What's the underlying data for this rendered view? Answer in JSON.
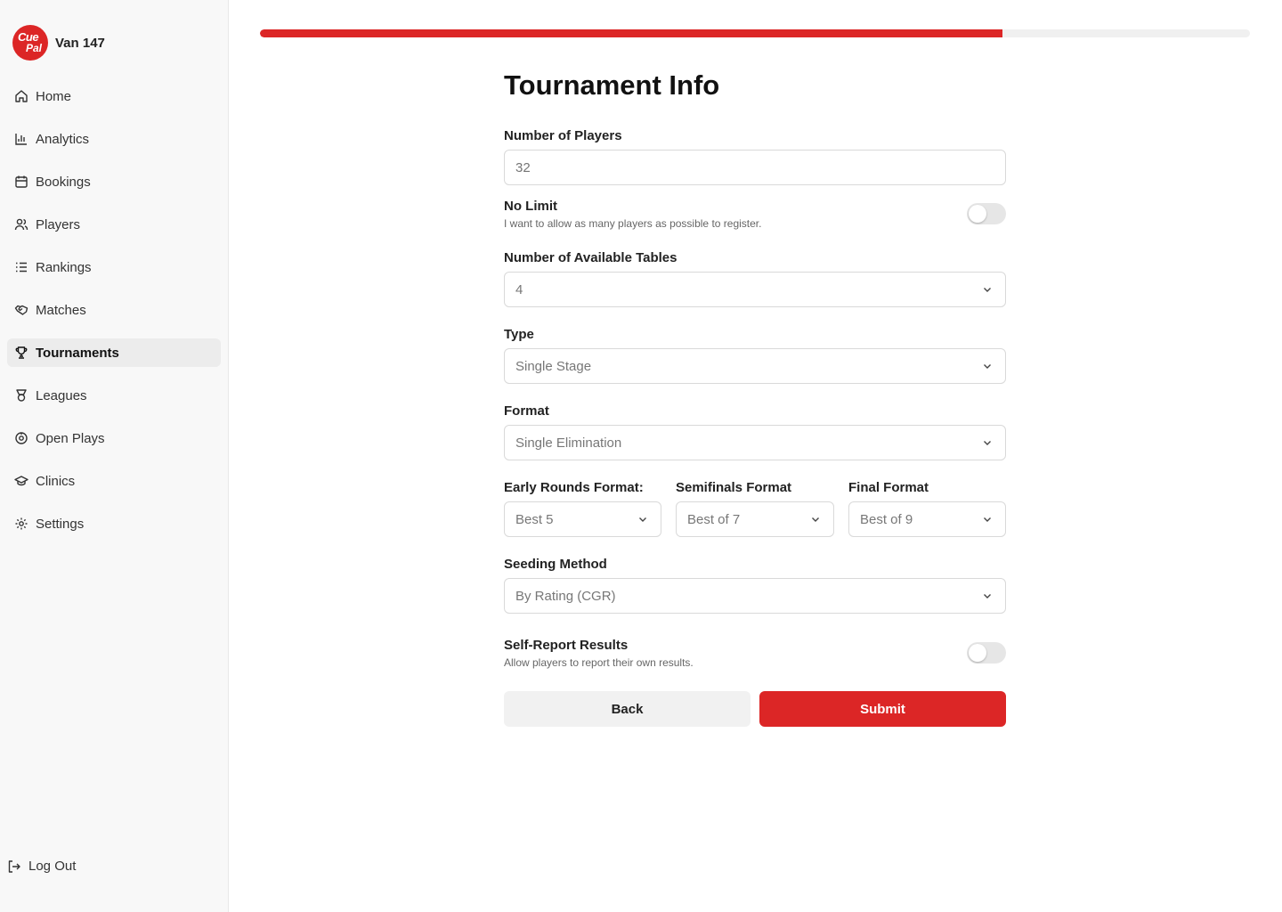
{
  "brand": {
    "logo_text_1": "Cue",
    "logo_text_2": "Pal",
    "name": "Van 147"
  },
  "sidebar": {
    "items": [
      {
        "label": "Home",
        "icon": "home-icon"
      },
      {
        "label": "Analytics",
        "icon": "bar-chart-icon"
      },
      {
        "label": "Bookings",
        "icon": "calendar-icon"
      },
      {
        "label": "Players",
        "icon": "users-icon"
      },
      {
        "label": "Rankings",
        "icon": "list-ordered-icon"
      },
      {
        "label": "Matches",
        "icon": "handshake-icon"
      },
      {
        "label": "Tournaments",
        "icon": "trophy-icon",
        "active": true
      },
      {
        "label": "Leagues",
        "icon": "medal-icon"
      },
      {
        "label": "Open Plays",
        "icon": "target-icon"
      },
      {
        "label": "Clinics",
        "icon": "graduation-cap-icon"
      },
      {
        "label": "Settings",
        "icon": "gear-icon"
      }
    ],
    "logout_label": "Log Out"
  },
  "progress": {
    "value_percent": 75
  },
  "form": {
    "title": "Tournament Info",
    "players_label": "Number of Players",
    "players_placeholder": "32",
    "no_limit_label": "No Limit",
    "no_limit_desc": "I want to allow as many players as possible to register.",
    "no_limit_on": false,
    "tables_label": "Number of Available Tables",
    "tables_value": "4",
    "type_label": "Type",
    "type_value": "Single Stage",
    "format_label": "Format",
    "format_value": "Single Elimination",
    "early_label": "Early Rounds Format:",
    "early_value": "Best 5",
    "semis_label": "Semifinals Format",
    "semis_value": "Best of 7",
    "final_label": "Final Format",
    "final_value": "Best of 9",
    "seeding_label": "Seeding Method",
    "seeding_value": "By Rating (CGR)",
    "self_report_label": "Self-Report Results",
    "self_report_desc": "Allow players to report their own results.",
    "self_report_on": false,
    "back_label": "Back",
    "submit_label": "Submit"
  },
  "colors": {
    "accent": "#dc2626",
    "sidebar_bg": "#f8f8f8"
  }
}
